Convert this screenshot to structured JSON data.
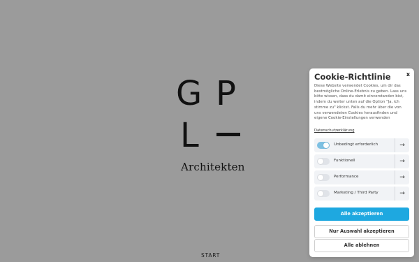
{
  "logo": {
    "letter_g": "G",
    "letter_p": "P",
    "letter_l": "L",
    "wordmark": "Architekten"
  },
  "start_label": "START",
  "cookie": {
    "title": "Cookie-Richtlinie",
    "close_label": "x",
    "description": "Diese Website verwendet Cookies, um dir das bestmögliche Online-Erlebnis zu geben. Lass uns bitte wissen, dass du damit einverstanden bist, indem du weiter unten auf die Option \"Ja, ich stimme zu\" klickst. Falls du mehr über die von uns verwendeten Cookies herausfinden und eigene Cookie-Einstellungen verwenden",
    "privacy_link": "Datenschutzerklärung",
    "categories": [
      {
        "label": "Unbedingt erforderlich",
        "enabled": true,
        "arrow": "→"
      },
      {
        "label": "Funktionell",
        "enabled": false,
        "arrow": "→"
      },
      {
        "label": "Performance",
        "enabled": false,
        "arrow": "→"
      },
      {
        "label": "Marketing / Third Party",
        "enabled": false,
        "arrow": "→"
      }
    ],
    "buttons": {
      "accept_all": "Alle akzeptieren",
      "accept_selection": "Nur Auswahl akzeptieren",
      "reject_all": "Alle ablehnen"
    },
    "colors": {
      "primary": "#1ea8e0",
      "toggle_on": "#7dc0e2",
      "background": "#9b9b9b"
    }
  }
}
